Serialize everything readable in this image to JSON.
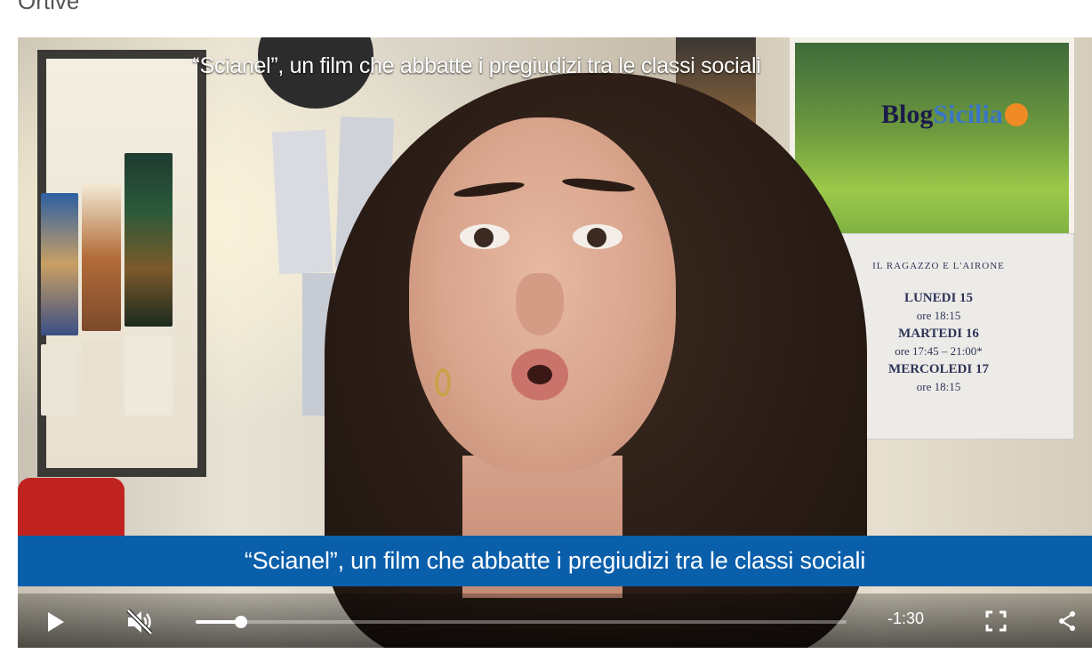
{
  "page": {
    "heading": "Ortive\""
  },
  "video": {
    "title": "“Scianel”, un film che abbatte i pregiudizi tra le classi sociali",
    "caption": "“Scianel”, un film che abbatte i pregiudizi tra le classi sociali",
    "logo": {
      "part1": "Blog",
      "part2": "Sicilia"
    },
    "scene_poster": {
      "title": "IL RAGAZZO E L'AIRONE",
      "lines": [
        "LUNEDI 15",
        "ore 18:15",
        "MARTEDI 16",
        "ore 17:45 – 21:00*",
        "MERCOLEDI 17",
        "ore 18:15"
      ]
    }
  },
  "controls": {
    "time_remaining": "-1:30",
    "progress_fraction": 0.07,
    "muted": true,
    "icons": {
      "play": "play-icon",
      "mute": "volume-muted-icon",
      "fullscreen": "fullscreen-icon",
      "share": "share-icon"
    }
  },
  "colors": {
    "caption_bar": "#0a5fab",
    "logo_accent": "#f08a24"
  }
}
